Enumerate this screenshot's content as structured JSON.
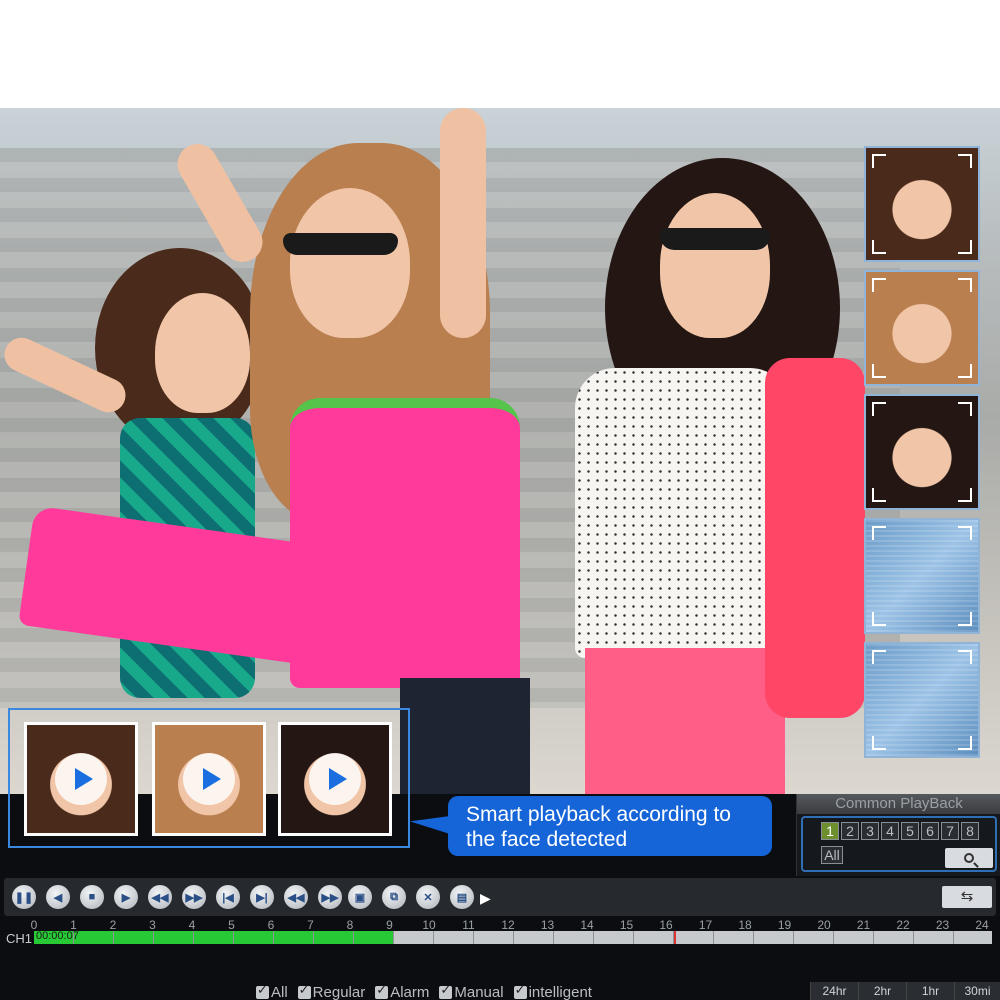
{
  "scene": {
    "callout_text": "Smart playback according to the face detected",
    "right_thumbnails": [
      "face-thumb-1",
      "face-thumb-2",
      "face-thumb-3",
      "face-scan-1",
      "face-scan-2"
    ],
    "clip_icons": [
      "play-icon",
      "play-icon",
      "play-icon"
    ]
  },
  "common_playback": {
    "title": "Common PlayBack",
    "channels": [
      "1",
      "2",
      "3",
      "4",
      "5",
      "6",
      "7",
      "8"
    ],
    "selected_channel": "1",
    "all_label": "All",
    "search_icon": "search-icon"
  },
  "controls": {
    "buttons": [
      "pause-icon",
      "prev-icon",
      "stop-icon",
      "play-icon",
      "rewind-icon",
      "fast-forward-icon",
      "skip-start-icon",
      "skip-end-icon",
      "prev-frame-icon",
      "next-frame-icon",
      "snapshot-icon",
      "copy-icon",
      "cut-icon",
      "save-icon"
    ],
    "sync_icon": "sync-icon"
  },
  "timeline": {
    "channel_label": "CH1",
    "time": "00:00:07",
    "hours": [
      "0",
      "1",
      "2",
      "3",
      "4",
      "5",
      "6",
      "7",
      "8",
      "9",
      "10",
      "11",
      "12",
      "13",
      "14",
      "15",
      "16",
      "17",
      "18",
      "19",
      "20",
      "21",
      "22",
      "23",
      "24"
    ],
    "recorded_until_hour": 9
  },
  "legend": {
    "items": [
      "All",
      "Regular",
      "Alarm",
      "Manual",
      "intelligent"
    ]
  },
  "zoom": {
    "options": [
      "24hr",
      "2hr",
      "1hr",
      "30mi"
    ]
  },
  "colors": {
    "accent": "#1565d8",
    "recording": "#27c934",
    "panel": "#0b0d10"
  }
}
